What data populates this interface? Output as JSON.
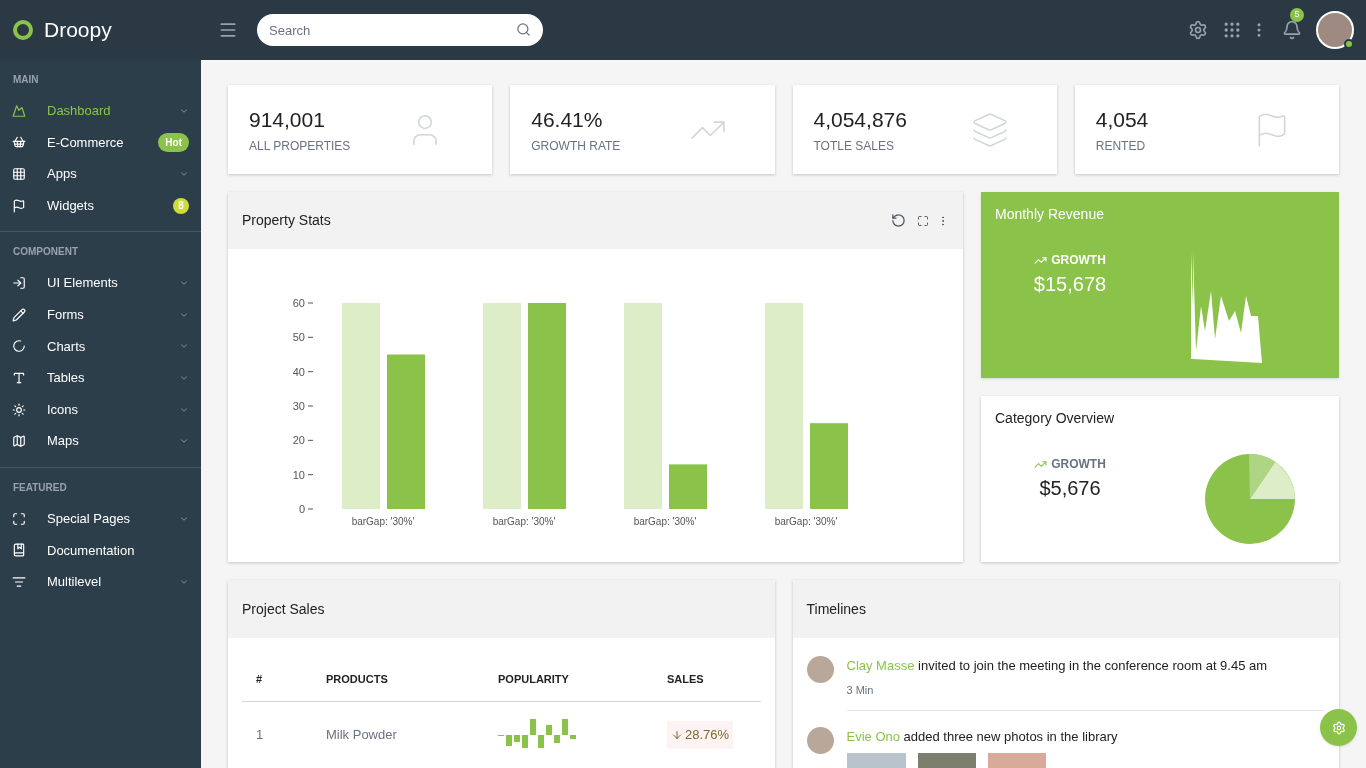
{
  "brand": {
    "name": "Droopy"
  },
  "search": {
    "placeholder": "Search"
  },
  "notifications": {
    "count": "5"
  },
  "user": {
    "online": true
  },
  "sidebar": {
    "sections": [
      {
        "title": "MAIN",
        "items": [
          {
            "label": "Dashboard",
            "selected": true,
            "kind": "chevron"
          },
          {
            "label": "E-Commerce",
            "selected": false,
            "kind": "badge",
            "badge": {
              "text": "Hot",
              "color": "#8bc34a"
            }
          },
          {
            "label": "Apps",
            "selected": false,
            "kind": "chevron"
          },
          {
            "label": "Widgets",
            "selected": false,
            "kind": "badge",
            "badge": {
              "text": "8",
              "color": "#cddc39"
            }
          }
        ]
      },
      {
        "title": "COMPONENT",
        "items": [
          {
            "label": "UI Elements",
            "selected": false,
            "kind": "chevron"
          },
          {
            "label": "Forms",
            "selected": false,
            "kind": "chevron"
          },
          {
            "label": "Charts",
            "selected": false,
            "kind": "chevron"
          },
          {
            "label": "Tables",
            "selected": false,
            "kind": "chevron"
          },
          {
            "label": "Icons",
            "selected": false,
            "kind": "chevron"
          },
          {
            "label": "Maps",
            "selected": false,
            "kind": "chevron"
          }
        ]
      },
      {
        "title": "FEATURED",
        "items": [
          {
            "label": "Special Pages",
            "selected": false,
            "kind": "chevron"
          },
          {
            "label": "Documentation",
            "selected": false,
            "kind": "plain"
          },
          {
            "label": "Multilevel",
            "selected": false,
            "kind": "chevron"
          }
        ]
      }
    ]
  },
  "stats": [
    {
      "value": "914,001",
      "label": "ALL PROPERTIES"
    },
    {
      "value": "46.41%",
      "label": "GROWTH RATE"
    },
    {
      "value": "4,054,876",
      "label": "TOTLE SALES"
    },
    {
      "value": "4,054",
      "label": "RENTED"
    }
  ],
  "property_stats": {
    "title": "Property Stats",
    "chart_data": {
      "type": "bar",
      "categories": [
        "barGap: '30%'",
        "barGap: '30%'",
        "barGap: '30%'",
        "barGap: '30%'"
      ],
      "series": [
        {
          "color": "#dcedc8",
          "values": [
            60,
            60,
            60,
            60
          ]
        },
        {
          "color": "#8bc34a",
          "values": [
            45,
            60,
            13,
            25
          ]
        }
      ],
      "ylim": [
        0,
        60
      ],
      "yticks": [
        0,
        10,
        20,
        30,
        40,
        50,
        60
      ]
    }
  },
  "monthly_revenue": {
    "title": "Monthly Revenue",
    "trend_label": "GROWTH",
    "amount": "$15,678"
  },
  "category_overview": {
    "title": "Category Overview",
    "trend_label": "GROWTH",
    "amount": "$5,676"
  },
  "project_sales": {
    "title": "Project Sales",
    "columns": [
      "#",
      "PRODUCTS",
      "POPULARITY",
      "SALES"
    ],
    "rows": [
      {
        "index": "1",
        "product": "Milk Powder",
        "sales": "28.76%"
      }
    ]
  },
  "timelines": {
    "title": "Timelines",
    "items": [
      {
        "kind": "note",
        "name": "Clay Masse",
        "text": "invited to join the meeting in the conference room at 9.45 am",
        "time": "3 Min"
      },
      {
        "kind": "photos",
        "name": "Evie Ono",
        "text": "added three new photos in the library"
      }
    ]
  }
}
